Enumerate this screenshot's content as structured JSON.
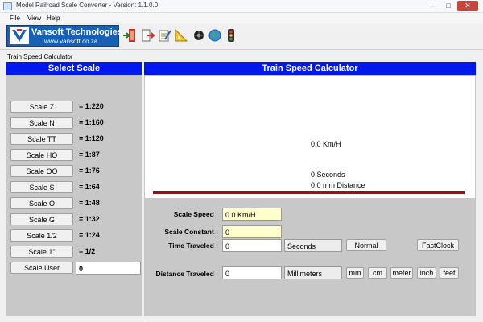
{
  "window": {
    "title": "Model Railroad Scale Converter - Version: 1.1.0.0",
    "minimize": "–",
    "maximize": "□",
    "close": "✕"
  },
  "menu": [
    "File",
    "View",
    "Help"
  ],
  "logo": {
    "name": "Vansoft Technologies",
    "url": "www.vansoft.co.za"
  },
  "toolbar_icons": [
    "exit-door-icon",
    "export-icon",
    "notepad-icon",
    "ruler-triangle-icon",
    "wheel-icon",
    "globe-icon",
    "traffic-light-icon"
  ],
  "caption": "Train Speed Calculator",
  "left": {
    "header": "Select Scale",
    "scales": [
      {
        "button": "Scale Z",
        "ratio": "= 1:220"
      },
      {
        "button": "Scale N",
        "ratio": "= 1:160"
      },
      {
        "button": "Scale TT",
        "ratio": "= 1:120"
      },
      {
        "button": "Scale HO",
        "ratio": "= 1:87"
      },
      {
        "button": "Scale OO",
        "ratio": "= 1:76"
      },
      {
        "button": "Scale S",
        "ratio": "= 1:64"
      },
      {
        "button": "Scale O",
        "ratio": "= 1:48"
      },
      {
        "button": "Scale G",
        "ratio": "= 1:32"
      },
      {
        "button": "Scale 1/2",
        "ratio": "= 1:24"
      },
      {
        "button": "Scale 1\"",
        "ratio": "= 1/2"
      }
    ],
    "user_button": "Scale User",
    "user_value": "0"
  },
  "right": {
    "header": "Train Speed Calculator",
    "display": {
      "speed": "0.0 Km/H",
      "seconds": "0 Seconds",
      "distance": "0.0 mm Distance"
    },
    "progress": 1.0,
    "progress_color": "#7f1d1d",
    "form": {
      "scale_speed_label": "Scale Speed :",
      "scale_speed_value": "0.0 Km/H",
      "scale_constant_label": "Scale Constant :",
      "scale_constant_value": "0",
      "time_label": "Time Traveled :",
      "time_value": "0",
      "time_unit": "Seconds",
      "normal_button": "Normal",
      "fastclock_button": "FastClock",
      "distance_label": "Distance Traveled :",
      "distance_value": "0",
      "distance_unit": "Millimeters",
      "unit_buttons": [
        "mm",
        "cm",
        "meter",
        "inch",
        "feet"
      ]
    }
  },
  "colors": {
    "header_blue": "#0018f0",
    "panel_gray": "#c8c8c8",
    "logo_blue": "#1760b3",
    "field_yellow": "#ffffcc"
  }
}
